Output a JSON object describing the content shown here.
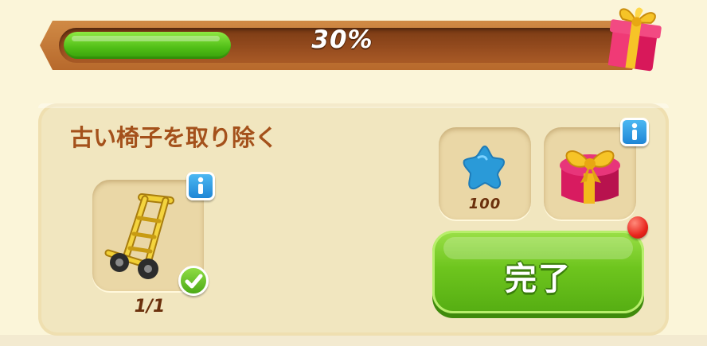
{
  "progress": {
    "percent": 30,
    "label": "30%",
    "fill_color": "#5cc41c"
  },
  "task": {
    "title": "古い椅子を取り除く",
    "item": {
      "icon": "hand-truck-icon",
      "count": "1/1",
      "completed": true
    }
  },
  "rewards": [
    {
      "icon": "blue-star-icon",
      "amount": "100"
    },
    {
      "icon": "gift-box-icon"
    }
  ],
  "complete_button": {
    "label": "完了",
    "color": "#6ec51e"
  },
  "colors": {
    "title": "#a4511b",
    "panel": "#f1e6bf",
    "bar_frame": "#c07430"
  }
}
